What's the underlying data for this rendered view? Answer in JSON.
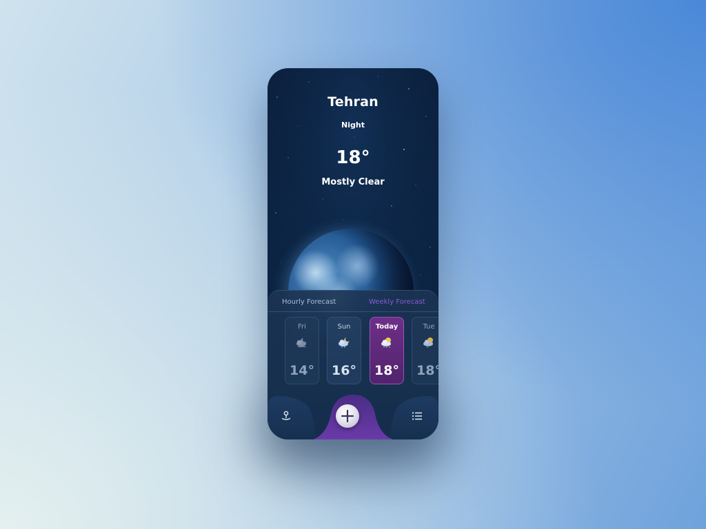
{
  "location": {
    "city": "Tehran",
    "period": "Night",
    "temperature": "18°",
    "condition": "Mostly Clear"
  },
  "forecast": {
    "tabs": [
      {
        "label": "Hourly Forecast",
        "active": false
      },
      {
        "label": "Weekly Forecast",
        "active": true
      }
    ],
    "days": [
      {
        "name": "Fri",
        "temp": "14°",
        "icon": "cloudy-night-icon",
        "selected": false
      },
      {
        "name": "Sun",
        "temp": "16°",
        "icon": "cloud-night-icon",
        "selected": false
      },
      {
        "name": "Today",
        "temp": "18°",
        "icon": "sun-cloud-rain-icon",
        "selected": true
      },
      {
        "name": "Tue",
        "temp": "18°",
        "icon": "sun-cloud-icon",
        "selected": false
      }
    ]
  },
  "nav": {
    "left_icon": "location-pin-icon",
    "center_icon": "add-icon",
    "right_icon": "list-icon"
  },
  "colors": {
    "accent_purple": "#8b5bd6",
    "selected_card": "#6e2f88",
    "panel_bg": "#1c3454",
    "sky_bg": "#0b1f3c"
  }
}
